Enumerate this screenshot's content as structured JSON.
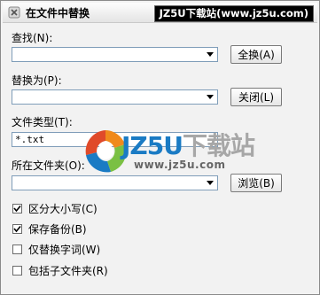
{
  "window": {
    "title": "在文件中替换",
    "watermark": "JZ5U下载站(www.jz5u.com)"
  },
  "find": {
    "label": "查找(N):",
    "value": "",
    "button": "全换(A)"
  },
  "replace": {
    "label": "替换为(P):",
    "value": "",
    "button": "关闭(L)"
  },
  "filetype": {
    "label": "文件类型(T):",
    "value": "*.txt"
  },
  "folder": {
    "label": "所在文件夹(O):",
    "value": "",
    "button": "浏览(B)"
  },
  "options": [
    {
      "label": "区分大小写(C)",
      "checked": true
    },
    {
      "label": "保存备份(B)",
      "checked": true
    },
    {
      "label": "仅替换字词(W)",
      "checked": false
    },
    {
      "label": "包括子文件夹(R)",
      "checked": false
    }
  ],
  "overlay_logo": {
    "brand": "JZ5U",
    "brand_cn": "下载站",
    "url": "www.jz5u.com"
  },
  "colors": {
    "field_border": "#7f9db9",
    "logo_blue": "#1a7bc4",
    "logo_orange": "#f08a1c",
    "logo_green": "#7ac043"
  }
}
